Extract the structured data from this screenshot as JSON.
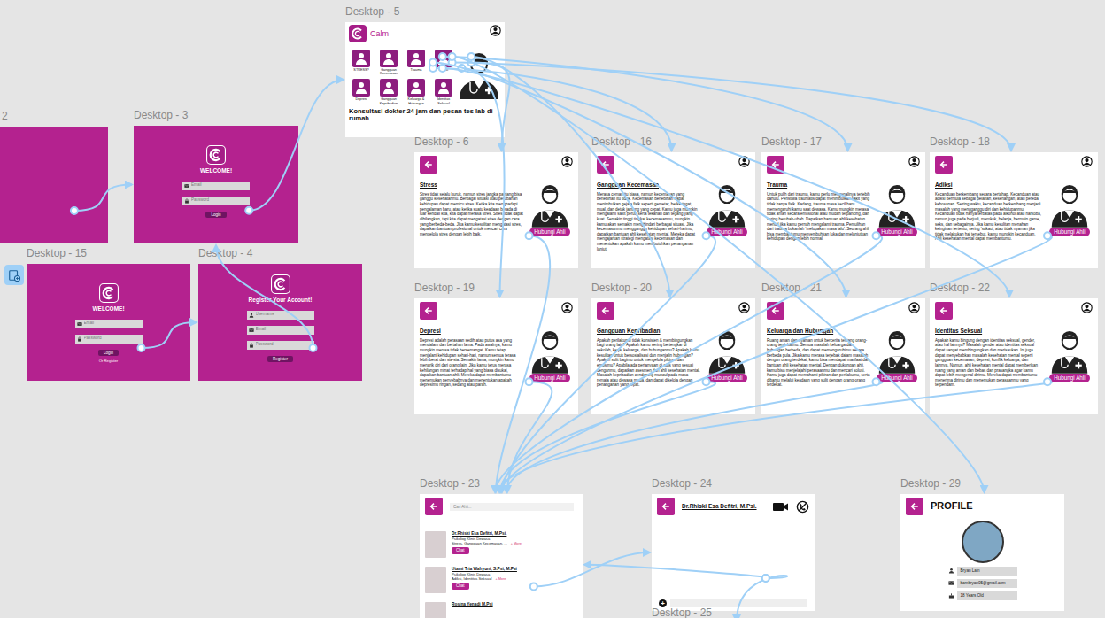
{
  "frames": [
    {
      "label": "2",
      "kind": "blank"
    },
    {
      "label": "Desktop - 3",
      "kind": "login",
      "welcome": "WELCOME!",
      "fields": [
        "Email",
        "Password"
      ],
      "button": "Login"
    },
    {
      "label": "Desktop - 5",
      "kind": "home",
      "brand": "Calm",
      "categories": [
        "STRESS?",
        "Gangguan Kecemasan",
        "Trauma",
        "Adiksi",
        "Depresi",
        "Gangguan Kepribadian",
        "Keluarga & Hubungan",
        "Identitas Seksual"
      ],
      "tagline": "Konsultasi dokter 24 jam dan pesan tes lab di rumah"
    },
    {
      "label": "Desktop - 15",
      "kind": "login",
      "welcome": "WELCOME!",
      "fields": [
        "Email",
        "Password"
      ],
      "button": "Login",
      "link": "Or Register"
    },
    {
      "label": "Desktop - 4",
      "kind": "register",
      "welcome": "Register Your Account!",
      "fields": [
        "Username",
        "Email",
        "Password"
      ],
      "button": "Register"
    },
    {
      "label": "Desktop - 6",
      "kind": "info",
      "title": "Stress",
      "button": "Hubungi Ahli",
      "body": "Stres tidak selalu buruk, namun stres jangka panjang bisa ganggu kesehatanmu. Berbagai situasi atau perubahan kehidupan dapat memicu stres. Ketika kita menghadapi pengalaman baru, atau ketika suatu keadaan berada di luar kendali kita, kita dapat merasa stres. Stres tidak dapat dihilangkan, tapi kita dapat mengatasi stres dengan cara yang berbeda-beda. Jika kamu kesulitan mengatasi stres, dapatkan bantuan profesional untuk mencari cara mengelola stres dengan lebih baik."
    },
    {
      "label": "Desktop - 16",
      "kind": "info",
      "title": "Gangguan Kecemasan",
      "button": "Hubungi Ahli",
      "body": "Merasa cemas itu biasa, namun kecemasan yang berlebihan itu tidak. Kecemasan berlebihan dapat menimbulkan gejala fisik seperti gemetar, berkeringat, mual, dan detak jantung yang cepat. Kamu juga mungkin mengalami sakit perut, serta tekanan dan tegang yang kuat. Semakin tinggi tingkat kecemasanmu, mungkin kamu akan semakin menghindari berbagai situasi. Jika kecemasanmu mengganggu kehidupan sehari-harimu, dapatkan bantuan ahli kesehatan mental. Mereka dapat mengajarkan strategi mengatasi kecemasan dan menentukan apakah kamu membutuhkan penanganan lanjut."
    },
    {
      "label": "Desktop - 17",
      "kind": "info",
      "title": "Trauma",
      "button": "Hubungi Ahli",
      "body": "Untuk pulih dari trauma, kamu perlu mengenalinya terlebih dahulu. Peristiwa traumatis dapat menimbulkan sakit yang tidak hanya fisik. Kadang, trauma masa kecil baru memengaruhi kamu saat dewasa. Kamu mungkin merasa tidak aman secara emosional atau mudah terpancing, dan sering berubah-ubah. Dapatkan bantuan ahli kesehatan mental jika kamu pernah mengalami trauma. Pemulihan dari trauma bukanlah 'melupakan masa lalu'. Seorang ahli bisa membantumu menyembuhkan luka dan melanjutkan kehidupan dengan lebih normal."
    },
    {
      "label": "Desktop - 18",
      "kind": "info",
      "title": "Adiksi",
      "button": "Hubungi Ahli",
      "body": "Kecanduan berkembang secara bertahap. Kecanduan atau adiksi bermula sebagai pelarian, kesenangan, atau pereda kebosanan. Seiring waktu, kecanduan berkembang menjadi masalah yang mengganggu diri dan kehidupanmu. Kecanduan tidak hanya terbatas pada alkohol atau narkoba, namun juga pada berjudi, merokok, belanja, bermain game, seks, dan sebagainya. Jika kamu kesulitan menahan keinginan tertentu, sering 'sakau', atau tidak nyaman jika tidak melakukan hal tersebut, kamu mungkin kecanduan. Ahli kesehatan mental dapat membantumu."
    },
    {
      "label": "Desktop - 19",
      "kind": "info",
      "title": "Depresi",
      "button": "Hubungi Ahli",
      "body": "Depresi adalah perasaan sedih atau putus asa yang mendalam dan bertahan lama. Pada awalnya, kamu mungkin merasa tidak bersemangat. Kamu tetap menjalani kehidupan sehari-hari, namun semua terasa lebih berat dan sia-sia. Semakin lama, mungkin kamu menarik diri dari orang lain. Jika kamu terus merasa kehilangan minat terhadap hal yang biasa disukai, dapatkan bantuan ahli. Mereka dapat membantumu menemukan penyebabnya dan menentukan apakah depresimu ringan, sedang atau parah."
    },
    {
      "label": "Desktop - 20",
      "kind": "info",
      "title": "Gangguan Kepribadian",
      "button": "Hubungi Ahli",
      "body": "Apakah perilakumu tidak konsisten & membingungkan bagi orang lain? Apakah kamu sering bertengkar di sekolah, kerja, keluarga, dan hubunganmu? Apakah kamu kesulitan untuk bersosialisasi dan menjalin hubungan? Apakah sulit bagimu untuk mengelola pikiran dan emosimu? Apabila ada pertanyaan di atas yang sesuai denganmu, dapatkan asesmen dari ahli kesehatan mental. Masalah kepribadian cenderung muncul pada masa remaja atau dewasa muda, dan dapat dikelola dengan penanganan yang tepat."
    },
    {
      "label": "Desktop - 21",
      "kind": "info",
      "title": "Keluarga dan Hubungan",
      "button": "Hubungi Ahli",
      "body": "Ruang aman dan nyaman untuk bercerita tentang orang-orang terdekatmu. Semua masalah keluarga dan hubungan berbeda, dan dapat memengaruhimu secara berbeda pula. Jika kamu merasa terjebak dalam masalah dengan orang terdekat, kamu bisa mendapat manfaat dari bantuan ahli kesehatan mental. Dengan dukungan ahli, kamu bisa menjelajahi perasaanmu dan mencari solusi. Kamu juga dapat memahami pikiran dan perilakumu, serta dibantu melalui keadaan yang sulit dengan orang-orang terdekat."
    },
    {
      "label": "Desktop - 22",
      "kind": "info",
      "title": "Identitas Seksual",
      "button": "Hubungi Ahli",
      "body": "Apakah kamu bingung dengan identitas seksual, gender, atau hal lainnya? Masalah gender atau identitas seksual dapat sangat membingungkan dan merisaukan. Ini juga dapat menyebabkan masalah kesehatan mental seperti gangguan kecemasan, depresi, konflik keluarga, dan lainnya. Namun, ahli kesehatan mental dapat memberikan ruang yang aman dan bebas dari prasangka agar kamu dapat lebih mengenal dirimu. Mereka dapat membantumu menerima dirimu dan menemukan perasaanmu yang terpendam."
    },
    {
      "label": "Desktop - 23",
      "kind": "experts",
      "search": "Cari Ahli...",
      "experts": [
        {
          "name": "Dr.Rhiski Esa Defitri, M.Psi.",
          "role": "Psikolog Klinis Dewasa",
          "tags": "Stress, Gangguan Kecemasan, ...",
          "more": "+ More",
          "button": "Chat"
        },
        {
          "name": "Utami Tria Wahyuni, S.Psi, M.Psi",
          "role": "Psikolog Klinis Dewasa",
          "tags": "Adiksi, Identitas Seksual",
          "more": "+ More",
          "button": "Chat"
        },
        {
          "name": "Rosina Yenadi M.Psi"
        }
      ]
    },
    {
      "label": "Desktop - 24",
      "kind": "chat",
      "contact": "Dr.Rhiski Esa Defitri, M.Psi.",
      "attach": "+"
    },
    {
      "label": "Desktop - 29",
      "kind": "profile",
      "title": "PROFILE",
      "fields": [
        "Bryan Lain",
        "bambryan05@gmail.com",
        "18 Years Old"
      ]
    },
    {
      "label": "Desktop - 25",
      "kind": "offscreen"
    }
  ],
  "connections": [
    {
      "from": 0,
      "to": 1
    },
    {
      "from": 1,
      "to": 2
    },
    {
      "from": 3,
      "to": 4
    },
    {
      "from": 4,
      "to": 1
    },
    {
      "from": 2,
      "to": 5
    },
    {
      "from": 2,
      "to": 6
    },
    {
      "from": 2,
      "to": 7
    },
    {
      "from": 2,
      "to": 8
    },
    {
      "from": 2,
      "to": 9
    },
    {
      "from": 2,
      "to": 10
    },
    {
      "from": 2,
      "to": 11
    },
    {
      "from": 2,
      "to": 12
    },
    {
      "from": 2,
      "to": 15
    },
    {
      "from": 5,
      "to": 13
    },
    {
      "from": 6,
      "to": 13
    },
    {
      "from": 7,
      "to": 13
    },
    {
      "from": 8,
      "to": 13
    },
    {
      "from": 9,
      "to": 13
    },
    {
      "from": 10,
      "to": 13
    },
    {
      "from": 11,
      "to": 13
    },
    {
      "from": 12,
      "to": 13
    },
    {
      "from": 13,
      "to": 14
    },
    {
      "from": 14,
      "to": 13
    },
    {
      "from": 14,
      "to": 16
    }
  ]
}
